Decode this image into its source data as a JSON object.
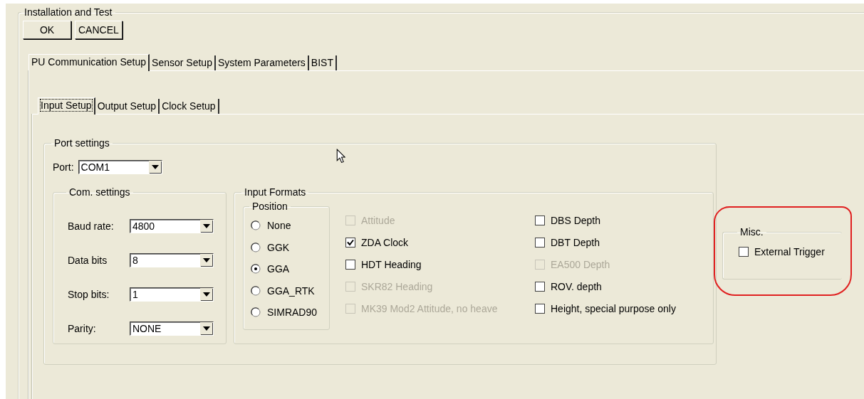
{
  "window": {
    "title": "Installation and Test"
  },
  "buttons": [
    {
      "label": "OK"
    },
    {
      "label": "CANCEL"
    }
  ],
  "tabs": [
    {
      "label": "PU Communication Setup",
      "selected": true
    },
    {
      "label": "Sensor Setup",
      "selected": false
    },
    {
      "label": "System Parameters",
      "selected": false
    },
    {
      "label": "BIST",
      "selected": false
    }
  ],
  "sub_tabs": [
    {
      "label": "Input Setup",
      "selected": true
    },
    {
      "label": "Output Setup",
      "selected": false
    },
    {
      "label": "Clock Setup",
      "selected": false
    }
  ],
  "port_settings": {
    "title": "Port settings",
    "port": {
      "label": "Port:",
      "value": "COM1"
    },
    "com_settings": {
      "title": "Com. settings",
      "fields": [
        {
          "label": "Baud rate:",
          "value": "4800"
        },
        {
          "label": "Data bits",
          "value": "8"
        },
        {
          "label": "Stop bits:",
          "value": "1"
        },
        {
          "label": "Parity:",
          "value": "NONE"
        }
      ]
    },
    "input_formats": {
      "title": "Input Formats",
      "position": {
        "title": "Position",
        "options": [
          {
            "label": "None",
            "selected": false
          },
          {
            "label": "GGK",
            "selected": false
          },
          {
            "label": "GGA",
            "selected": true
          },
          {
            "label": "GGA_RTK",
            "selected": false
          },
          {
            "label": "SIMRAD90",
            "selected": false
          }
        ]
      },
      "formats_left": [
        {
          "label": "Attitude",
          "checked": false,
          "disabled": true
        },
        {
          "label": "ZDA Clock",
          "checked": true,
          "disabled": false
        },
        {
          "label": "HDT Heading",
          "checked": false,
          "disabled": false
        },
        {
          "label": "SKR82 Heading",
          "checked": false,
          "disabled": true
        },
        {
          "label": "MK39 Mod2 Attitude, no heave",
          "checked": false,
          "disabled": true
        }
      ],
      "formats_right": [
        {
          "label": "DBS Depth",
          "checked": false,
          "disabled": false
        },
        {
          "label": "DBT Depth",
          "checked": false,
          "disabled": false
        },
        {
          "label": "EA500 Depth",
          "checked": false,
          "disabled": true
        },
        {
          "label": "ROV. depth",
          "checked": false,
          "disabled": false
        },
        {
          "label": "Height, special purpose only",
          "checked": false,
          "disabled": false
        }
      ]
    }
  },
  "misc": {
    "title": "Misc.",
    "options": [
      {
        "label": "External Trigger",
        "checked": false,
        "disabled": false
      }
    ]
  }
}
